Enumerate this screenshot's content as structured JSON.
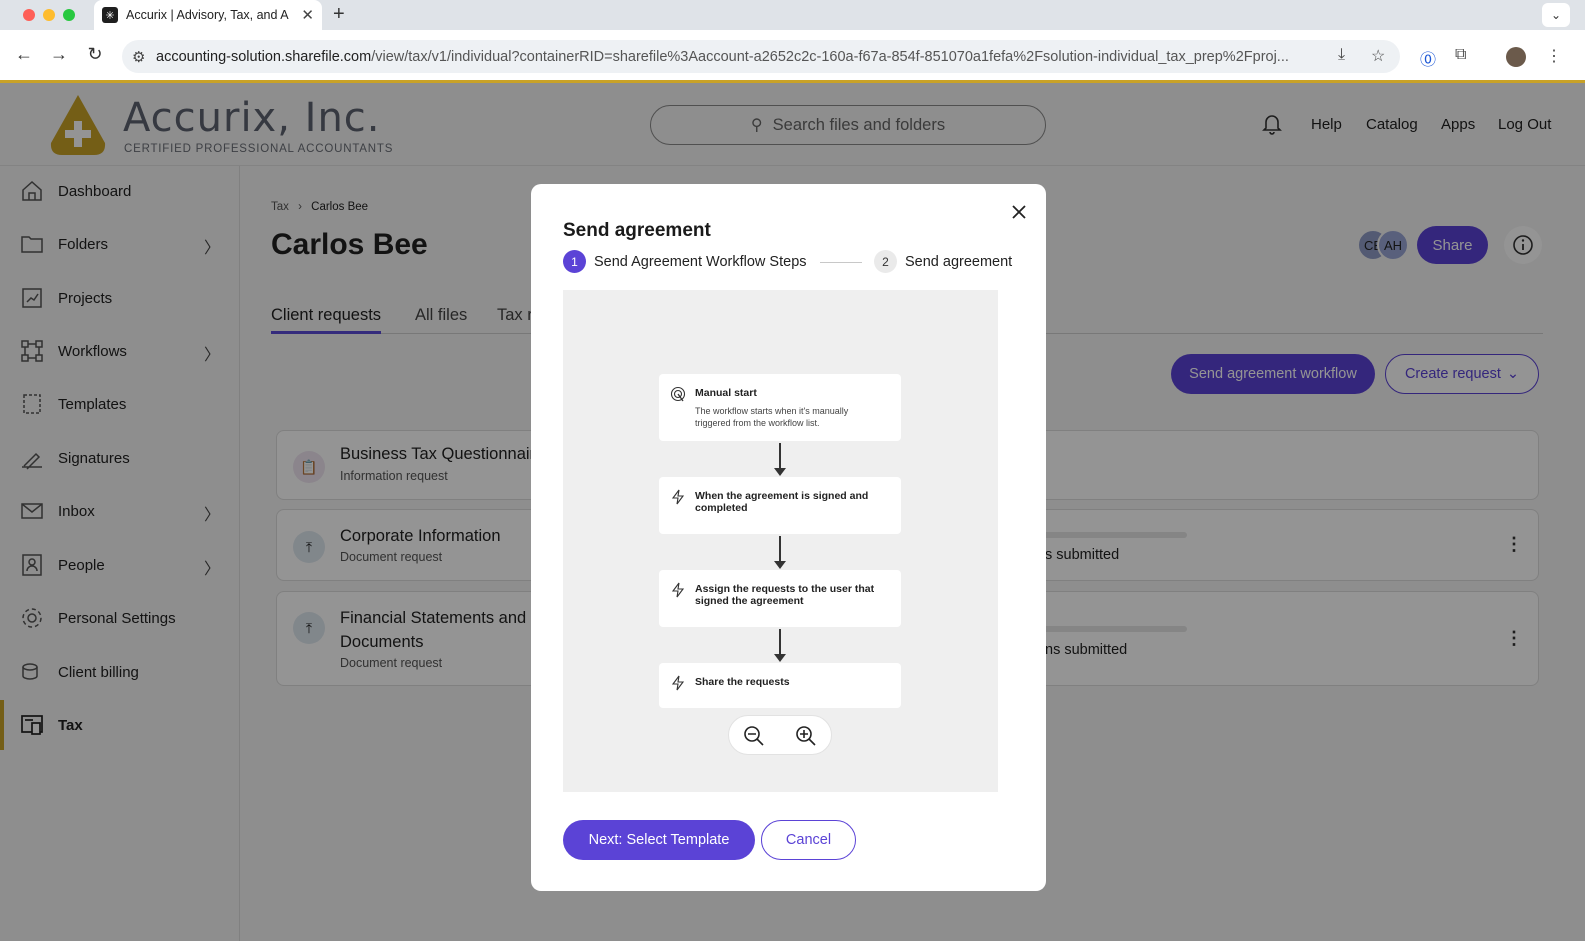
{
  "browser": {
    "tab_title": "Accurix | Advisory, Tax, and A",
    "tab_favicon": "✳",
    "new_tab": "+",
    "url_host": "accounting-solution.sharefile.com",
    "url_path": "/view/tax/v1/individual?containerRID=sharefile%3Aaccount-a2652c2c-160a-f67a-854f-851070a1fefa%2Fsolution-individual_tax_prep%2Fproj..."
  },
  "header": {
    "brand_name": "Accurix, Inc.",
    "brand_tagline": "CERTIFIED PROFESSIONAL ACCOUNTANTS",
    "search_placeholder": "Search files and folders",
    "links": [
      "Help",
      "Catalog",
      "Apps",
      "Log Out"
    ]
  },
  "sidebar": {
    "items": [
      {
        "label": "Dashboard",
        "icon": "home-icon"
      },
      {
        "label": "Folders",
        "icon": "folder-icon",
        "has_children": true
      },
      {
        "label": "Projects",
        "icon": "projects-icon"
      },
      {
        "label": "Workflows",
        "icon": "workflow-icon",
        "has_children": true
      },
      {
        "label": "Templates",
        "icon": "template-icon"
      },
      {
        "label": "Signatures",
        "icon": "signature-icon"
      },
      {
        "label": "Inbox",
        "icon": "mail-icon",
        "has_children": true
      },
      {
        "label": "People",
        "icon": "person-icon",
        "has_children": true
      },
      {
        "label": "Personal Settings",
        "icon": "gear-icon"
      },
      {
        "label": "Client billing",
        "icon": "billing-icon"
      },
      {
        "label": "Tax",
        "icon": "tax-icon",
        "active": true
      }
    ]
  },
  "main": {
    "breadcrumb": [
      "Tax",
      "Carlos Bee"
    ],
    "title": "Carlos Bee",
    "tabs": [
      "Client requests",
      "All files",
      "Tax r"
    ],
    "avatars": [
      "CE",
      "AH"
    ],
    "share_label": "Share",
    "send_workflow_label": "Send agreement workflow",
    "create_request_label": "Create request",
    "requests": [
      {
        "name": "Business Tax Questionnair",
        "type": "Information request",
        "status": ""
      },
      {
        "name": "Corporate Information",
        "type": "Document request",
        "status": "s submitted"
      },
      {
        "name": "Financial Statements and Documents",
        "type": "Document request",
        "status": "ns submitted"
      }
    ]
  },
  "modal": {
    "title": "Send agreement",
    "steps": [
      {
        "number": "1",
        "label": "Send Agreement Workflow Steps",
        "active": true
      },
      {
        "number": "2",
        "label": "Send agreement",
        "active": false
      }
    ],
    "workflow": [
      {
        "title": "Manual start",
        "description": "The workflow starts when it's manually triggered from the workflow list.",
        "icon": "hand-tap-icon"
      },
      {
        "title": "When the agreement is signed and completed",
        "description": "",
        "icon": "lightning-icon"
      },
      {
        "title": "Assign the requests to the user that signed the agreement",
        "description": "",
        "icon": "lightning-icon"
      },
      {
        "title": "Share the requests",
        "description": "",
        "icon": "lightning-icon"
      }
    ],
    "next_label": "Next: Select Template",
    "cancel_label": "Cancel"
  },
  "colors": {
    "accent": "#5b43d6",
    "brand_gold": "#c9a227"
  }
}
